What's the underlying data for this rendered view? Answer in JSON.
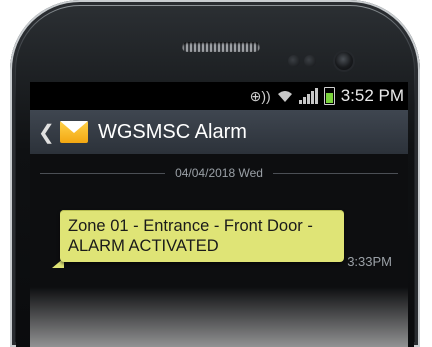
{
  "status_bar": {
    "time": "3:52 PM",
    "icons": [
      "nfc-icon",
      "wifi-icon",
      "signal-icon",
      "battery-icon"
    ]
  },
  "app_bar": {
    "back_icon": "chevron-left-icon",
    "app_icon": "envelope-icon",
    "title": "WGSMSC Alarm"
  },
  "thread": {
    "date": "04/04/2018 Wed",
    "messages": [
      {
        "text": "Zone 01 - Entrance - Front Door - ALARM ACTIVATED",
        "time": "3:33PM"
      }
    ]
  },
  "colors": {
    "bubble": "#dfe476",
    "app_bar": "#363c44",
    "battery": "#7bd33d"
  }
}
